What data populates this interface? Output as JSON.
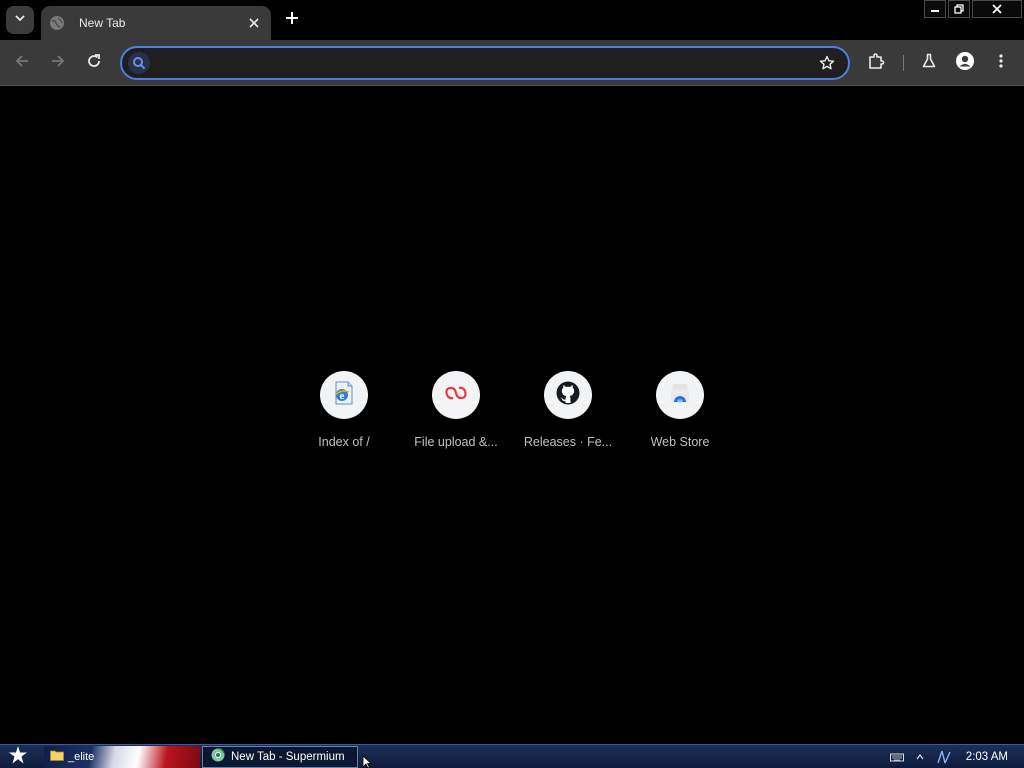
{
  "browser": {
    "tab": {
      "title": "New Tab"
    },
    "omnibox": {
      "value": "",
      "placeholder": ""
    },
    "accent_color": "#4d7fde"
  },
  "toolbar": {
    "icons": [
      "back-icon",
      "forward-icon",
      "reload-icon",
      "search-icon",
      "bookmark-star-icon",
      "extensions-icon",
      "labs-flask-icon",
      "profile-icon",
      "menu-kebab-icon"
    ]
  },
  "shortcuts": [
    {
      "label": "Index of /",
      "icon": "ie-page-icon"
    },
    {
      "label": "File upload &...",
      "icon": "red-chain-icon"
    },
    {
      "label": "Releases · Fe...",
      "icon": "github-icon"
    },
    {
      "label": "Web Store",
      "icon": "web-store-icon"
    }
  ],
  "taskbar": {
    "folder_label": "_elite",
    "browser_label": "New Tab - Supermium",
    "clock": "2:03 AM"
  }
}
